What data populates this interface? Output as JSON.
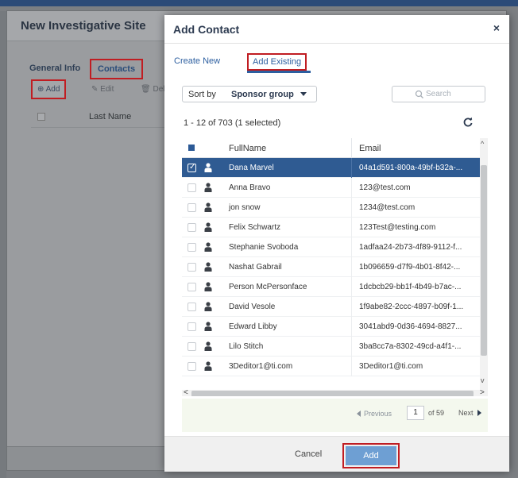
{
  "background_dialog": {
    "title": "New Investigative Site",
    "tabs": [
      "General Info",
      "Contacts"
    ],
    "toolbar": {
      "add": "Add",
      "edit": "Edit",
      "delete": "Delet"
    },
    "grid_header": "Last Name"
  },
  "modal": {
    "title": "Add Contact",
    "close": "×",
    "tabs": {
      "create_new": "Create New",
      "add_existing": "Add Existing"
    },
    "sort": {
      "label": "Sort by",
      "value": "Sponsor group"
    },
    "search": {
      "placeholder": "Search"
    },
    "count_text": "1 - 12 of 703 (1 selected)",
    "columns": {
      "fullname": "FullName",
      "email": "Email"
    },
    "rows": [
      {
        "name": "Dana Marvel",
        "email": "04a1d591-800a-49bf-b32a-...",
        "selected": true
      },
      {
        "name": "Anna Bravo",
        "email": "123@test.com",
        "selected": false
      },
      {
        "name": "jon snow",
        "email": "1234@test.com",
        "selected": false
      },
      {
        "name": "Felix Schwartz",
        "email": "123Test@testing.com",
        "selected": false
      },
      {
        "name": "Stephanie Svoboda",
        "email": "1adfaa24-2b73-4f89-9112-f...",
        "selected": false
      },
      {
        "name": "Nashat Gabrail",
        "email": "1b096659-d7f9-4b01-8f42-...",
        "selected": false
      },
      {
        "name": "Person McPersonface",
        "email": "1dcbcb29-bb1f-4b49-b7ac-...",
        "selected": false
      },
      {
        "name": "David Vesole",
        "email": "1f9abe82-2ccc-4897-b09f-1...",
        "selected": false
      },
      {
        "name": "Edward Libby",
        "email": "3041abd9-0d36-4694-8827...",
        "selected": false
      },
      {
        "name": "Lilo Stitch",
        "email": "3ba8cc7a-8302-49cd-a4f1-...",
        "selected": false
      },
      {
        "name": "3Deditor1@ti.com",
        "email": "3Deditor1@ti.com",
        "selected": false
      }
    ],
    "pager": {
      "previous": "Previous",
      "page": "1",
      "of": "of 59",
      "next": "Next"
    },
    "footer": {
      "cancel": "Cancel",
      "add": "Add"
    }
  },
  "colors": {
    "accent": "#2d5fa0",
    "selected_row": "#2f5b92",
    "highlight_box": "#c01d22",
    "primary_button": "#6e9fd3"
  }
}
